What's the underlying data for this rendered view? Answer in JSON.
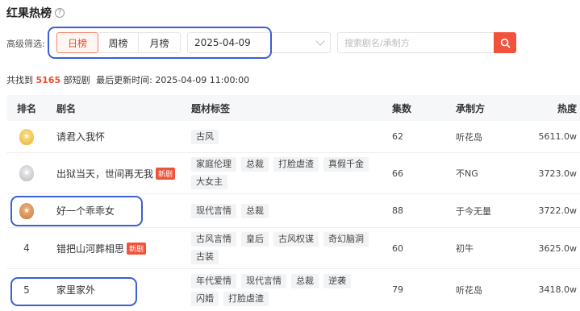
{
  "header": {
    "title": "红果热榜",
    "help_glyph": "?"
  },
  "filters": {
    "label": "高级筛选:",
    "tabs": [
      "日榜",
      "周榜",
      "月榜"
    ],
    "active_tab": "日榜",
    "date_value": "2025-04-09",
    "search_placeholder": "搜索剧名/承制方",
    "search_value": ""
  },
  "summary": {
    "prefix": "共找到",
    "count": "5165",
    "suffix": "部短剧",
    "updated_label": "最后更新时间:",
    "updated_value": "2025-04-09 11:00:00"
  },
  "table": {
    "columns": [
      "排名",
      "剧名",
      "题材标签",
      "集数",
      "承制方",
      "热度"
    ],
    "rows": [
      {
        "rank": "1",
        "medal": "gold",
        "name": "请君入我怀",
        "is_new": false,
        "tags": [
          "古风"
        ],
        "episodes": "62",
        "producer": "听花岛",
        "heat": "5611.0w"
      },
      {
        "rank": "2",
        "medal": "silver",
        "name": "出狱当天，世间再无我",
        "is_new": true,
        "tags": [
          "家庭伦理",
          "总裁",
          "打脸虐渣",
          "真假千金",
          "大女主"
        ],
        "episodes": "66",
        "producer": "不NG",
        "heat": "3723.0w"
      },
      {
        "rank": "3",
        "medal": "bronze",
        "name": "好一个乖乖女",
        "is_new": false,
        "tags": [
          "现代言情",
          "总裁"
        ],
        "episodes": "88",
        "producer": "于今无量",
        "heat": "3722.0w"
      },
      {
        "rank": "4",
        "medal": "",
        "name": "错把山河葬相思",
        "is_new": true,
        "tags": [
          "古风言情",
          "皇后",
          "古风权谋",
          "奇幻脑洞",
          "古装"
        ],
        "episodes": "60",
        "producer": "初牛",
        "heat": "3625.0w"
      },
      {
        "rank": "5",
        "medal": "",
        "name": "家里家外",
        "is_new": false,
        "tags": [
          "年代爱情",
          "现代言情",
          "总裁",
          "逆袭",
          "闪婚",
          "打脸虐渣"
        ],
        "episodes": "79",
        "producer": "听花岛",
        "heat": "3418.0w"
      }
    ],
    "new_badge": "新剧"
  },
  "colors": {
    "accent": "#ee4d2d",
    "annotation": "#3b5fd6",
    "header_bg": "#f6f7f9"
  }
}
